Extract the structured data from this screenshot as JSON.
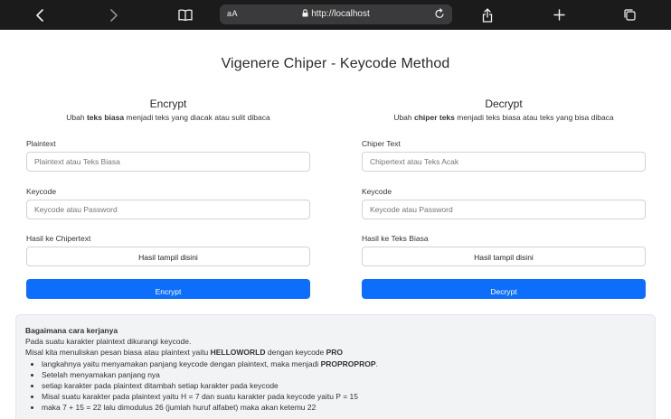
{
  "browser": {
    "text_size_label": "aA",
    "url": "http://localhost"
  },
  "page": {
    "title": "Vigenere Chiper - Keycode Method"
  },
  "encrypt": {
    "heading": "Encrypt",
    "sub_before": "Ubah ",
    "sub_bold": "teks biasa",
    "sub_after": " menjadi teks yang diacak atau sulit dibaca",
    "plaintext_label": "Plaintext",
    "plaintext_placeholder": "Plaintext atau Teks Biasa",
    "keycode_label": "Keycode",
    "keycode_placeholder": "Keycode atau Password",
    "result_label": "Hasil ke Chipertext",
    "result_value": "Hasil tampil disini",
    "button_label": "Encrypt"
  },
  "decrypt": {
    "heading": "Decrypt",
    "sub_before": "Ubah ",
    "sub_bold": "chiper teks",
    "sub_after": " menjadi teks biasa atau teks yang bisa dibaca",
    "chipertext_label": "Chiper Text",
    "chipertext_placeholder": "Chipertext atau Teks Acak",
    "keycode_label": "Keycode",
    "keycode_placeholder": "Keycode atau Password",
    "result_label": "Hasil ke Teks Biasa",
    "result_value": "Hasil tampil disini",
    "button_label": "Decrypt"
  },
  "info": {
    "title": "Bagaimana cara kerjanya",
    "line1": "Pada suatu karakter plaintext dikurangi keycode.",
    "line2_before": "Misal kita menuliskan pesan biasa atau plaintext yaitu ",
    "line2_bold1": "HELLOWORLD",
    "line2_mid": " dengan keycode ",
    "line2_bold2": "PRO",
    "bullet1_before": "langkahnya yaitu menyamakan panjang keycode dengan plaintext, maka menjadi ",
    "bullet1_bold": "PROPROPROP",
    "bullet1_after": ".",
    "bullet2": "Setelah menyamakan panjang nya",
    "bullet3": "setiap karakter pada plaintext ditambah setiap karakter pada keycode",
    "bullet4": "Misal suatu karakter pada plaintext yaitu H = 7 dan suatu karakter pada keycode yaitu P = 15",
    "bullet5": "maka 7 + 15 = 22 lalu dimodulus 26 (jumlah huruf alfabet) maka akan ketemu 22"
  },
  "colors": {
    "toolbar_bg": "#1b1b1c",
    "url_field_bg": "#3a3a3c",
    "primary_button": "#0d6efd",
    "info_bg": "#f1f3f5"
  },
  "icons": {
    "toolbar": [
      "back-icon",
      "forward-icon",
      "bookmarks-icon",
      "lock-icon",
      "reload-icon",
      "share-icon",
      "new-tab-icon",
      "tabs-icon"
    ]
  }
}
